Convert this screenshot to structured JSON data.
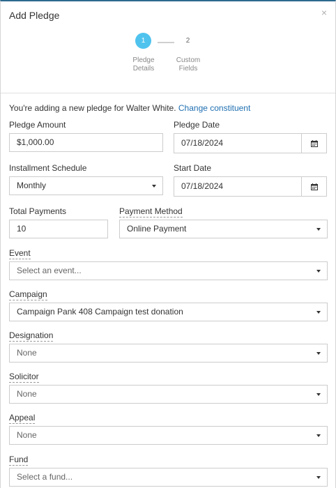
{
  "modal": {
    "title": "Add Pledge",
    "close_glyph": "×"
  },
  "steps": [
    {
      "number": "1",
      "label_line1": "Pledge",
      "label_line2": "Details"
    },
    {
      "number": "2",
      "label_line1": "Custom",
      "label_line2": "Fields"
    }
  ],
  "intro": {
    "text": "You're adding a new pledge for Walter White.",
    "link": "Change constituent"
  },
  "form": {
    "pledge_amount": {
      "label": "Pledge Amount",
      "value": "$1,000.00"
    },
    "pledge_date": {
      "label": "Pledge Date",
      "value": "07/18/2024"
    },
    "installment_schedule": {
      "label": "Installment Schedule",
      "value": "Monthly"
    },
    "start_date": {
      "label": "Start Date",
      "value": "07/18/2024"
    },
    "total_payments": {
      "label": "Total Payments",
      "value": "10"
    },
    "payment_method": {
      "label": "Payment Method",
      "value": "Online Payment"
    },
    "event": {
      "label": "Event",
      "placeholder": "Select an event..."
    },
    "campaign": {
      "label": "Campaign",
      "value": "Campaign Pank 408 Campaign test donation"
    },
    "designation": {
      "label": "Designation",
      "value": "None"
    },
    "solicitor": {
      "label": "Solicitor",
      "value": "None"
    },
    "appeal": {
      "label": "Appeal",
      "value": "None"
    },
    "fund": {
      "label": "Fund",
      "placeholder": "Select a fund..."
    }
  },
  "colors": {
    "accent": "#4fc3ee",
    "link": "#1f6fb2",
    "header_border": "#2d6a8f"
  }
}
